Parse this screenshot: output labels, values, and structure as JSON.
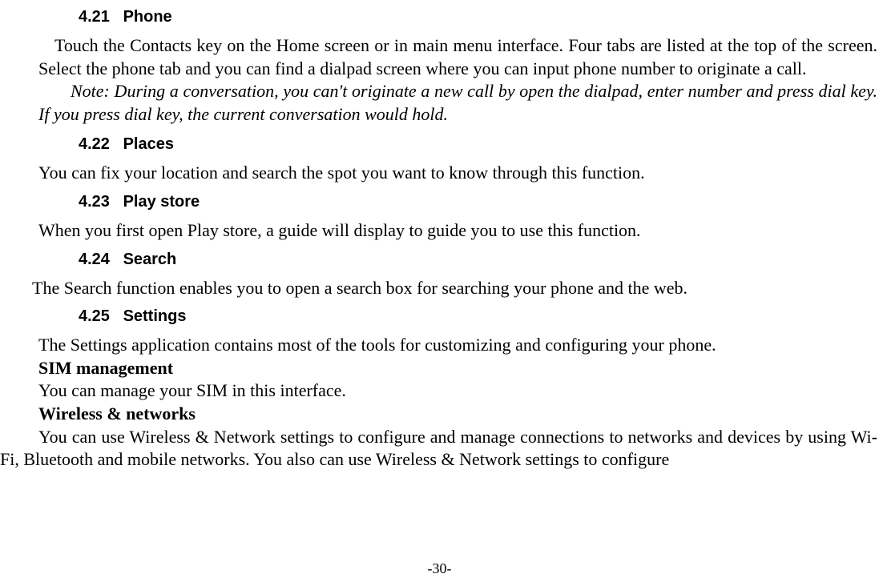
{
  "sections": {
    "s421": {
      "num": "4.21",
      "title": "Phone",
      "para1": "Touch the Contacts key on the Home screen or in main menu interface. Four tabs are listed at the top of the screen. Select the phone tab and you can find a dialpad screen where you can input phone number to originate a call.",
      "note": "Note: During a conversation, you can't originate a new call by open the dialpad, enter number and press dial key. If you press dial key, the current conversation would hold."
    },
    "s422": {
      "num": "4.22",
      "title": "Places",
      "para1": "You can fix your location and search the spot you want to know through this function."
    },
    "s423": {
      "num": "4.23",
      "title": "Play store",
      "para1_prefix": "When you first open",
      "para1_suffix": "Play store, a guide will display to guide you to use this function."
    },
    "s424": {
      "num": "4.24",
      "title": "Search",
      "para1": "The Search function enables you to open a search box for searching your phone and the web."
    },
    "s425": {
      "num": "4.25",
      "title": "Settings",
      "para1": "The Settings application contains most of the tools for customizing and configuring your phone.",
      "sim_title": "SIM management",
      "sim_body": "You can manage your SIM in this interface.",
      "wireless_title": "Wireless & networks",
      "wireless_body": "You can use Wireless & Network settings to configure and manage connections to networks and devices by using Wi-Fi, Bluetooth and mobile networks. You also can use Wireless & Network settings to configure"
    }
  },
  "footer": "-30-"
}
